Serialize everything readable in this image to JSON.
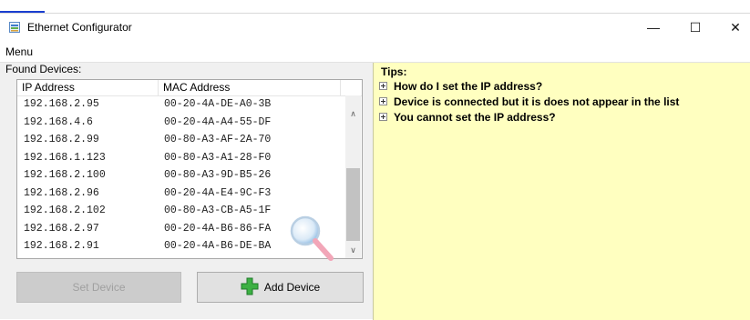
{
  "overlay": {
    "top_link_text": ""
  },
  "window": {
    "title": "Ethernet Configurator",
    "controls": {
      "minimize": "—",
      "maximize": "☐",
      "close": "✕"
    }
  },
  "menu": {
    "label": "Menu"
  },
  "devices": {
    "label": "Found Devices:",
    "columns": [
      "IP Address",
      "MAC Address"
    ],
    "rows": [
      {
        "ip": "192.168.2.95",
        "mac": "00-20-4A-DE-A0-3B"
      },
      {
        "ip": "192.168.4.6",
        "mac": "00-20-4A-A4-55-DF"
      },
      {
        "ip": "192.168.2.99",
        "mac": "00-80-A3-AF-2A-70"
      },
      {
        "ip": "192.168.1.123",
        "mac": "00-80-A3-A1-28-F0"
      },
      {
        "ip": "192.168.2.100",
        "mac": "00-80-A3-9D-B5-26"
      },
      {
        "ip": "192.168.2.96",
        "mac": "00-20-4A-E4-9C-F3"
      },
      {
        "ip": "192.168.2.102",
        "mac": "00-80-A3-CB-A5-1F"
      },
      {
        "ip": "192.168.2.97",
        "mac": "00-20-4A-B6-86-FA"
      },
      {
        "ip": "192.168.2.91",
        "mac": "00-20-4A-B6-DE-BA"
      }
    ],
    "scroll_up": "∧",
    "scroll_down": "∨"
  },
  "buttons": {
    "set_device": "Set Device",
    "add_device": "Add Device"
  },
  "tips": {
    "title": "Tips:",
    "items": [
      "How do I set the IP address?",
      "Device is connected but it is does not appear in the list",
      "You cannot set the IP address?"
    ]
  },
  "colors": {
    "tips_background": "#ffffc0",
    "add_icon": "#3cb043",
    "link_blue": "#1a3fd0"
  },
  "icons": {
    "app": "network-configurator-icon",
    "add": "plus-icon",
    "search": "magnifier-icon",
    "expander": "expand-plus-icon"
  }
}
